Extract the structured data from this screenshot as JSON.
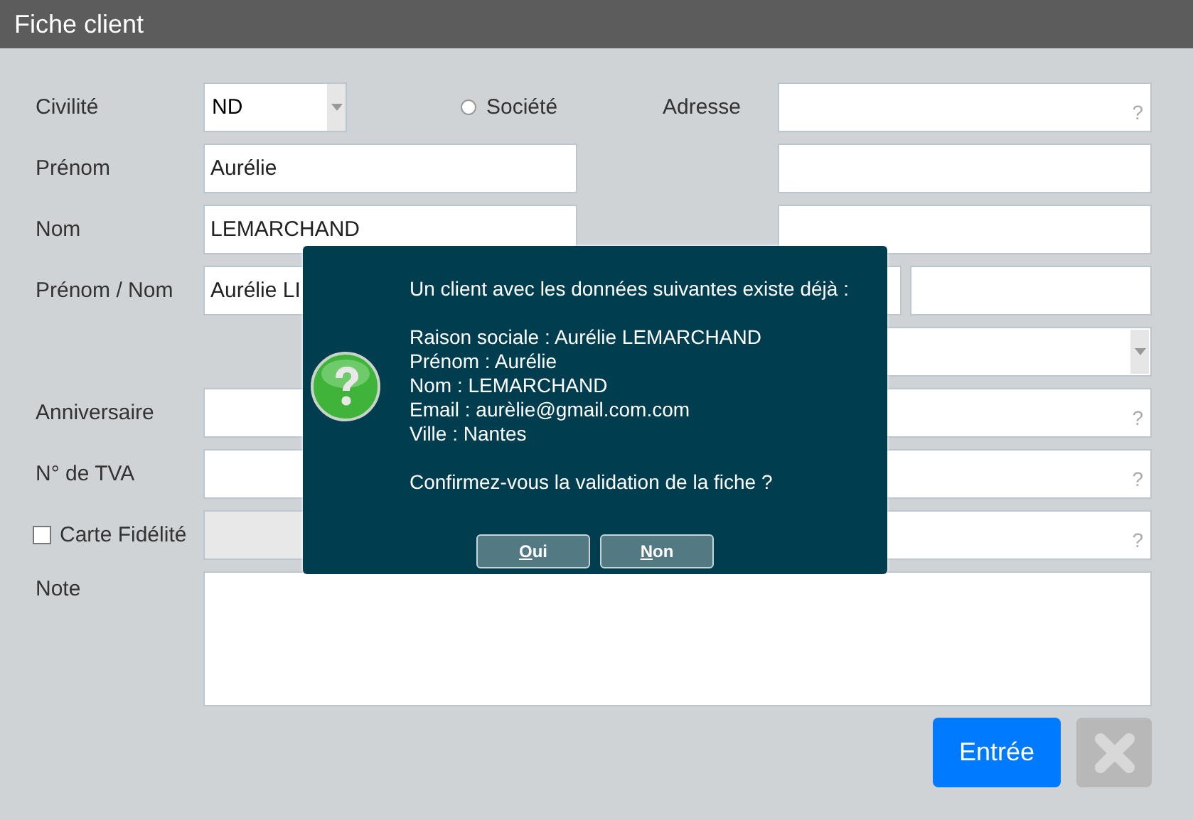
{
  "window": {
    "title": "Fiche client"
  },
  "form": {
    "civilite": {
      "label": "Civilité",
      "value": "ND"
    },
    "societe": {
      "label": "Société",
      "selected": false
    },
    "adresse": {
      "label": "Adresse",
      "hint": "?"
    },
    "prenom": {
      "label": "Prénom",
      "value": "Aurélie"
    },
    "nom": {
      "label": "Nom",
      "value": "LEMARCHAND"
    },
    "prenom_nom": {
      "label": "Prénom / Nom",
      "value": "Aurélie LI"
    },
    "anniversaire": {
      "label": "Anniversaire",
      "hint": "?"
    },
    "tva": {
      "label": "N° de TVA",
      "hint": "?"
    },
    "carte": {
      "label": "Carte Fidélité",
      "checked": false,
      "hint": "?"
    },
    "note": {
      "label": "Note"
    }
  },
  "buttons": {
    "enter": "Entrée",
    "cancel_disabled": true
  },
  "dialog": {
    "paragraphs": [
      [
        "Un client avec les données suivantes existe déjà :"
      ],
      [
        "Raison sociale : Aurélie LEMARCHAND",
        "Prénom : Aurélie",
        "Nom : LEMARCHAND",
        "Email : aurèlie@gmail.com.com",
        "Ville : Nantes"
      ],
      [
        "Confirmez-vous la validation de la fiche ?"
      ]
    ],
    "buttons": [
      "Oui",
      "Non"
    ]
  }
}
